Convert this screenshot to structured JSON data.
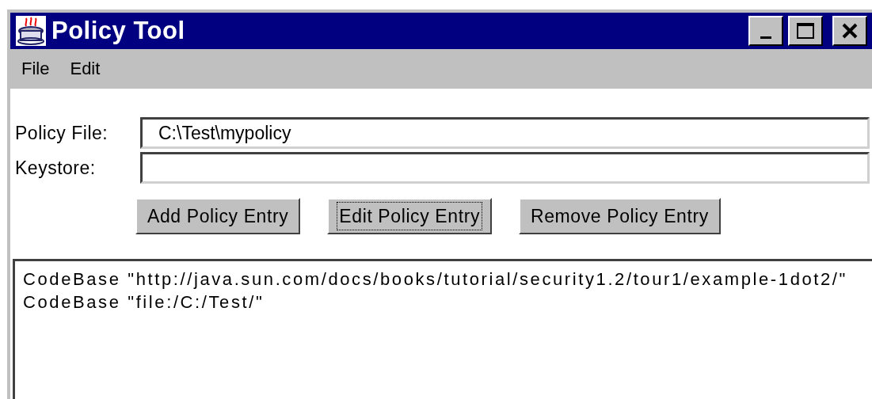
{
  "window": {
    "title": "Policy Tool"
  },
  "menu": [
    "File",
    "Edit"
  ],
  "fields": [
    {
      "label": "Policy File:",
      "value": "C:\\Test\\mypolicy"
    },
    {
      "label": "Keystore:"
    }
  ],
  "buttons": [
    {
      "label": "Add Policy Entry",
      "focused": false
    },
    {
      "label": "Edit Policy Entry",
      "focused": true
    },
    {
      "label": "Remove Policy Entry",
      "focused": false
    }
  ],
  "entries": [
    "CodeBase \"http://java.sun.com/docs/books/tutorial/security1.2/tour1/example-1dot2/\"",
    "CodeBase \"file:/C:/Test/\""
  ]
}
